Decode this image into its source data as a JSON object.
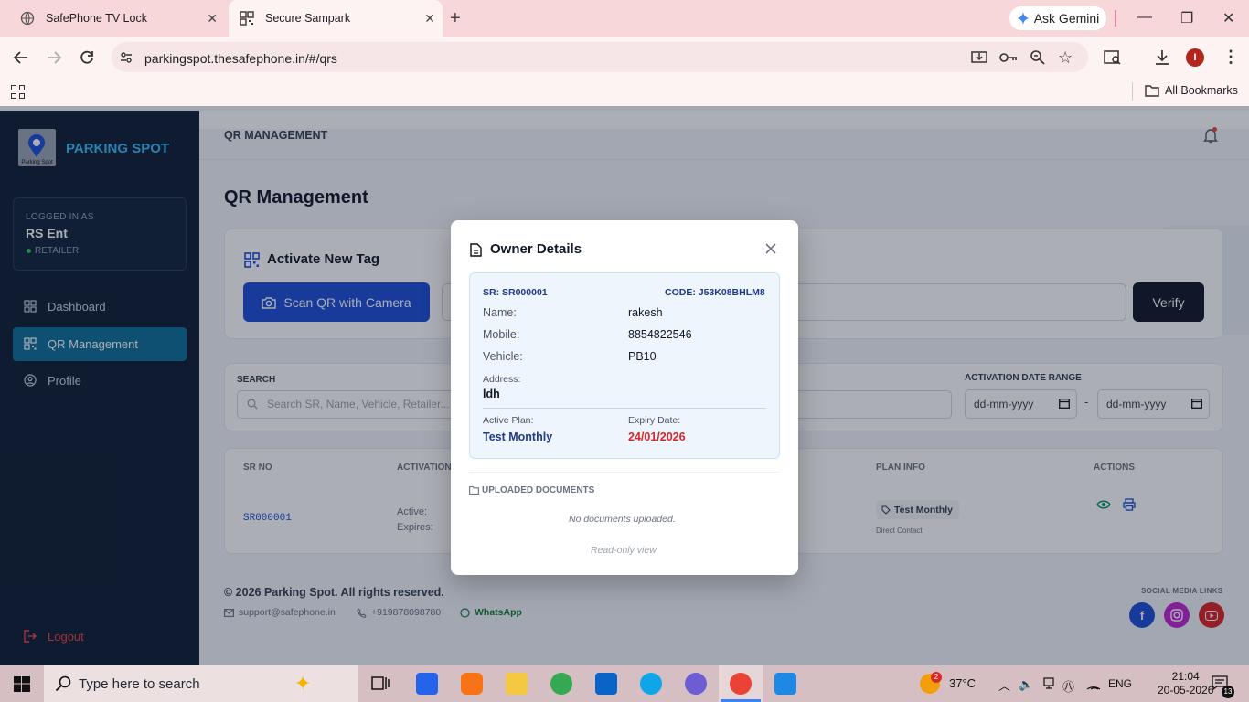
{
  "browser": {
    "tabs": [
      {
        "label": "SafePhone TV Lock"
      },
      {
        "label": "Secure Sampark"
      }
    ],
    "url": "parkingspot.thesafephone.in/#/qrs",
    "gemini_label": "Ask Gemini",
    "bookmarks_label": "All Bookmarks"
  },
  "sidebar": {
    "brand": "PARKING SPOT",
    "logo_text": "Parking Spot",
    "logged_in_label": "LOGGED IN AS",
    "user_name": "RS Ent",
    "role": "RETAILER",
    "items": [
      {
        "label": "Dashboard"
      },
      {
        "label": "QR Management"
      },
      {
        "label": "Profile"
      }
    ],
    "logout": "Logout"
  },
  "header": {
    "section": "QR MANAGEMENT"
  },
  "main": {
    "title": "QR Management",
    "activate": {
      "title": "Activate New Tag",
      "scan_label": "Scan QR with Camera",
      "verify_label": "Verify"
    },
    "filters": {
      "search_label": "SEARCH",
      "search_placeholder": "Search SR, Name, Vehicle, Retailer...",
      "date_label": "ACTIVATION DATE RANGE",
      "date_from": "dd-mm-yyyy",
      "date_sep": "-",
      "date_to": "dd-mm-yyyy"
    },
    "table": {
      "headers": [
        "SR NO",
        "ACTIVATION",
        "PLAN INFO",
        "ACTIONS"
      ],
      "row": {
        "sr": "SR000001",
        "active_label": "Active:",
        "expires_label": "Expires:",
        "plan": "Test Monthly",
        "plan_sub": "Direct Contact"
      }
    }
  },
  "footer": {
    "copyright": "© 2026 Parking Spot. All rights reserved.",
    "email": "support@safephone.in",
    "phone": "+919878098780",
    "whatsapp": "WhatsApp",
    "social_label": "SOCIAL MEDIA LINKS"
  },
  "modal": {
    "title": "Owner Details",
    "sr": "SR: SR000001",
    "code": "CODE: J53K08BHLM8",
    "fields": [
      {
        "label": "Name:",
        "value": "rakesh"
      },
      {
        "label": "Mobile:",
        "value": "8854822546"
      },
      {
        "label": "Vehicle:",
        "value": "PB10"
      }
    ],
    "address_label": "Address:",
    "address_value": "ldh",
    "plan_label": "Active Plan:",
    "plan_value": "Test Monthly",
    "expiry_label": "Expiry Date:",
    "expiry_value": "24/01/2026",
    "docs_label": "UPLOADED DOCUMENTS",
    "no_docs": "No documents uploaded.",
    "readonly": "Read-only view"
  },
  "taskbar": {
    "search_placeholder": "Type here to search",
    "temperature": "37°C",
    "language": "ENG",
    "time": "21:04",
    "date": "20-05-2026",
    "weather_badge": "2",
    "notifications": "13"
  },
  "colors": {
    "sidebar_bg": "#0f1e33",
    "brand": "#38bdf8",
    "primary": "#1d4ed8",
    "active_nav": "#0e6f98",
    "expiry": "#dc2626",
    "tabbar": "#f8d7da"
  }
}
